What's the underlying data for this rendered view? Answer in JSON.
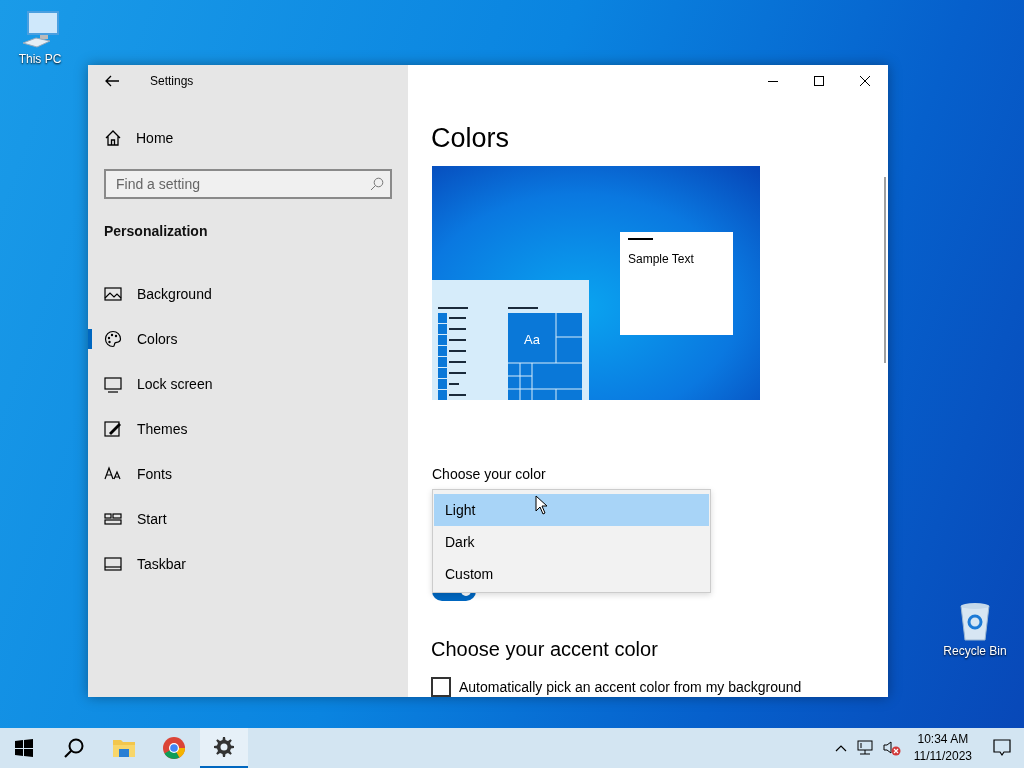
{
  "desktop_icons": [
    {
      "kind": "computer",
      "label": "This PC"
    },
    {
      "kind": "bin",
      "label": "Recycle Bin"
    }
  ],
  "window": {
    "title": "Settings",
    "sidebar": {
      "home": "Home",
      "search": {
        "placeholder": "Find a setting"
      },
      "section": "Personalization",
      "items": [
        {
          "kind": "picture",
          "label": "Background",
          "selected": false
        },
        {
          "kind": "palette",
          "label": "Colors",
          "selected": true
        },
        {
          "kind": "monitor",
          "label": "Lock screen",
          "selected": false
        },
        {
          "kind": "brush",
          "label": "Themes",
          "selected": false
        },
        {
          "kind": "font",
          "label": "Fonts",
          "selected": false
        },
        {
          "kind": "start",
          "label": "Start",
          "selected": false
        },
        {
          "kind": "taskbar",
          "label": "Taskbar",
          "selected": false
        }
      ]
    },
    "content": {
      "heading": "Colors",
      "preview": {
        "tile_label": "Aa",
        "sample_text": "Sample Text"
      },
      "choose_color_label": "Choose your color",
      "dropdown": {
        "options": [
          {
            "label": "Light",
            "selected": true
          },
          {
            "label": "Dark",
            "selected": false
          },
          {
            "label": "Custom",
            "selected": false
          }
        ]
      },
      "toggle": {
        "on": true
      },
      "accent_heading": "Choose your accent color",
      "auto_accent": {
        "checked": false,
        "label": "Automatically pick an accent color from my background"
      }
    }
  },
  "taskbar": {
    "apps": [
      {
        "kind": "start",
        "active": false
      },
      {
        "kind": "search",
        "active": false
      },
      {
        "kind": "folder",
        "active": false
      },
      {
        "kind": "browser",
        "active": false
      },
      {
        "kind": "settings",
        "active": true
      }
    ],
    "clock": {
      "time": "10:34 AM",
      "date": "11/11/2023"
    }
  }
}
